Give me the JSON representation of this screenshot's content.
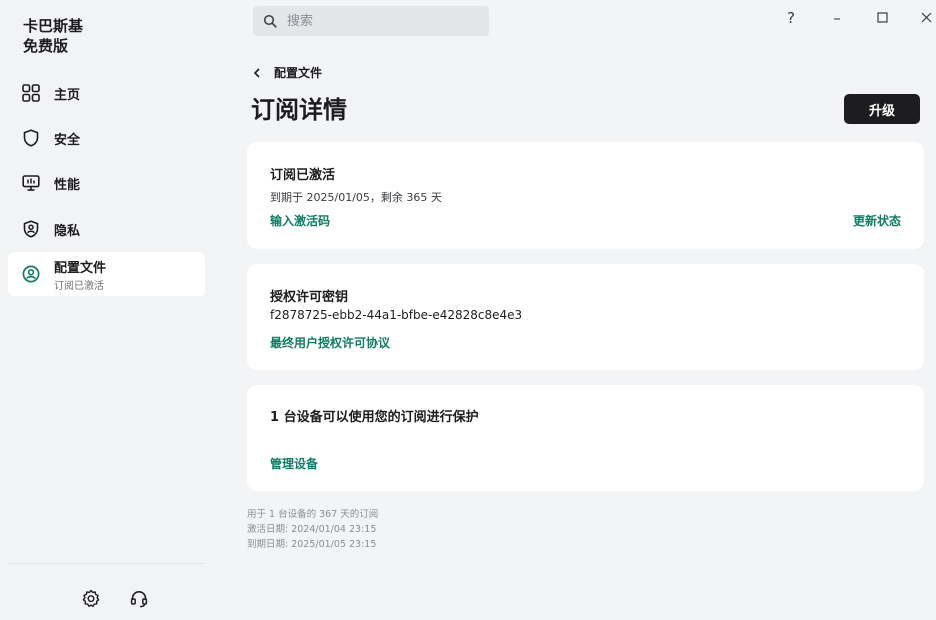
{
  "sidebar": {
    "brand_line1": "卡巴斯基",
    "brand_line2": "免费版",
    "items": [
      {
        "label": "主页",
        "icon": "home-grid-icon"
      },
      {
        "label": "安全",
        "icon": "shield-icon"
      },
      {
        "label": "性能",
        "icon": "monitor-icon"
      },
      {
        "label": "隐私",
        "icon": "privacy-shield-icon"
      },
      {
        "label": "配置文件",
        "sublabel": "订阅已激活",
        "icon": "profile-icon"
      }
    ],
    "bottom_icons": [
      "settings-gear-icon",
      "support-headset-icon"
    ]
  },
  "search": {
    "placeholder": "搜索"
  },
  "window_controls": {
    "help": "?",
    "minimize": "–",
    "maximize": "□",
    "close": "×"
  },
  "breadcrumb": {
    "label": "配置文件"
  },
  "page": {
    "title": "订阅详情",
    "upgrade_label": "升级"
  },
  "cards": {
    "subscription": {
      "title": "订阅已激活",
      "expiry": "到期于 2025/01/05，剩余 365 天",
      "enter_code_link": "输入激活码",
      "refresh_link": "更新状态"
    },
    "license": {
      "title": "授权许可密钥",
      "key": "f2878725-ebb2-44a1-bfbe-e42828c8e4e3",
      "eula_link": "最终用户授权许可协议"
    },
    "devices": {
      "title": "1 台设备可以使用您的订阅进行保护",
      "manage_link": "管理设备"
    }
  },
  "footnote": {
    "line1": "用于 1 台设备的 367 天的订阅",
    "line2": "激活日期: 2024/01/04 23:15",
    "line3": "到期日期: 2025/01/05 23:15"
  },
  "colors": {
    "accent": "#0f7d66",
    "dark_button": "#1d1d1f",
    "background": "#f3f4f5",
    "card": "#ffffff"
  }
}
